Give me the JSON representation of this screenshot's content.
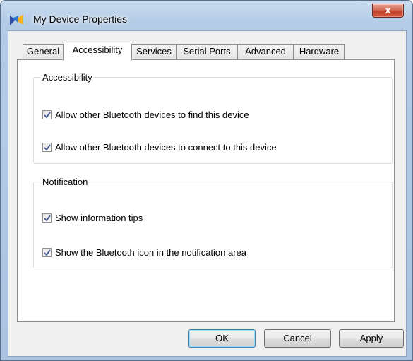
{
  "window": {
    "title": "My Device Properties",
    "close_label": "x"
  },
  "tabs": [
    {
      "label": "General"
    },
    {
      "label": "Accessibility",
      "selected": true
    },
    {
      "label": "Services"
    },
    {
      "label": "Serial Ports"
    },
    {
      "label": "Advanced"
    },
    {
      "label": "Hardware"
    }
  ],
  "accessibility_group": {
    "title": "Accessibility",
    "options": [
      {
        "label": "Allow other Bluetooth devices to find this device",
        "checked": true
      },
      {
        "label": "Allow other Bluetooth devices to connect to this device",
        "checked": true
      }
    ]
  },
  "notification_group": {
    "title": "Notification",
    "options": [
      {
        "label": "Show information tips",
        "checked": true
      },
      {
        "label": "Show the Bluetooth icon in the notification area",
        "checked": true
      }
    ]
  },
  "buttons": {
    "ok": "OK",
    "cancel": "Cancel",
    "apply": "Apply"
  },
  "icons": {
    "app": "bluetooth-device-icon",
    "checkmark": "checkmark-icon"
  },
  "colors": {
    "checkmark": "#4a5f97",
    "close_button": "#c7472f"
  }
}
